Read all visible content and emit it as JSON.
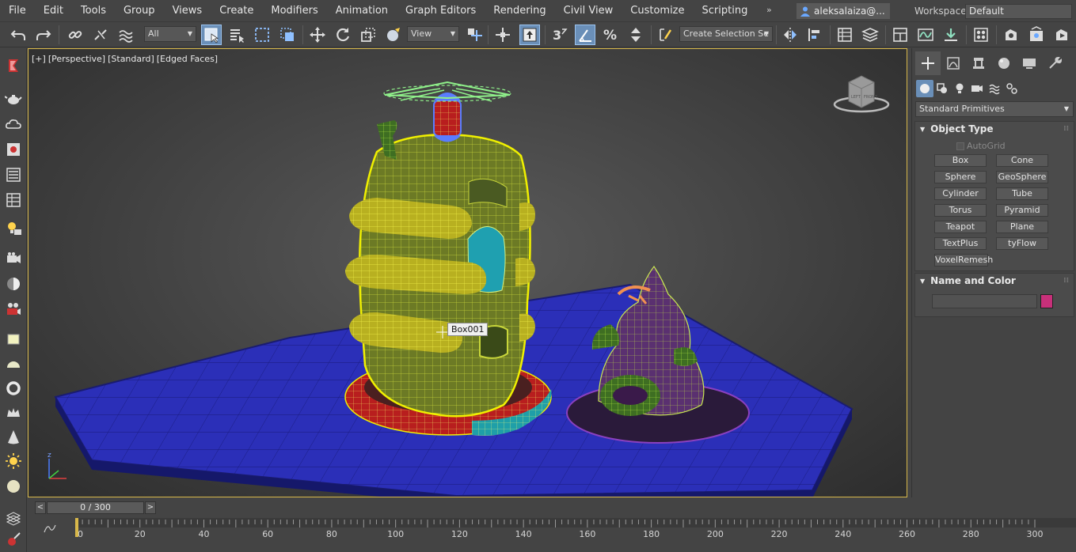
{
  "menu": {
    "items": [
      "File",
      "Edit",
      "Tools",
      "Group",
      "Views",
      "Create",
      "Modifiers",
      "Animation",
      "Graph Editors",
      "Rendering",
      "Civil View",
      "Customize",
      "Scripting"
    ],
    "overflow": "»",
    "user": "aleksalaiza@...",
    "workspaces_label": "Workspaces:",
    "workspace_value": "Default"
  },
  "toolbar": {
    "selection_filter": "All",
    "reference_coord": "View",
    "snap_3": "3",
    "selection_set_placeholder": "Create Selection Se"
  },
  "viewport": {
    "label_plus": "[+]",
    "label_view": "[Perspective]",
    "label_shading": "[Standard]",
    "label_edges": "[Edged Faces]",
    "tooltip": "Box001",
    "gizmo_text": "FRONT",
    "gizmo_text2": "LEFT"
  },
  "command_panel": {
    "category_dropdown": "Standard Primitives",
    "object_type_title": "Object Type",
    "autogrid_label": "AutoGrid",
    "buttons": [
      "Box",
      "Cone",
      "Sphere",
      "GeoSphere",
      "Cylinder",
      "Tube",
      "Torus",
      "Pyramid",
      "Teapot",
      "Plane",
      "TextPlus",
      "tyFlow",
      "VoxelRemesh"
    ],
    "name_color_title": "Name and Color",
    "swatch_color": "#c8307a"
  },
  "timeline": {
    "frame_display": "0 / 300",
    "prev": "<",
    "next": ">",
    "ruler_labels": [
      "0",
      "20",
      "40",
      "60",
      "80",
      "100",
      "120",
      "140",
      "160",
      "180",
      "200",
      "220",
      "240",
      "260",
      "280",
      "300"
    ]
  },
  "colors": {
    "accent_active": "#6a8fb8",
    "viewport_border": "#d8b84a",
    "selection_yellow": "#f0f000",
    "ground_blue": "#2b2fb8"
  }
}
